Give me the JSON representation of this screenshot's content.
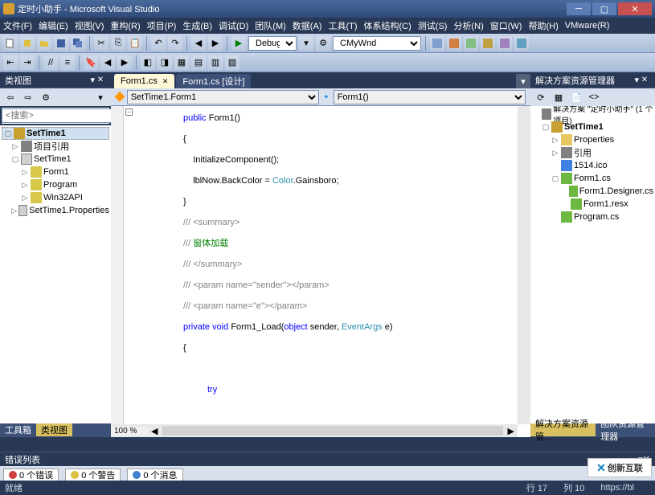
{
  "title": "定时小助手 - Microsoft Visual Studio",
  "window_buttons": {
    "min": "─",
    "max": "▢",
    "close": "✕"
  },
  "menu": [
    "文件(F)",
    "编辑(E)",
    "视图(V)",
    "重构(R)",
    "项目(P)",
    "生成(B)",
    "调试(D)",
    "团队(M)",
    "数据(A)",
    "工具(T)",
    "体系结构(C)",
    "测试(S)",
    "分析(N)",
    "窗口(W)",
    "帮助(H)",
    "VMware(R)"
  ],
  "toolbar": {
    "config": "Debug",
    "target": "CMyWnd"
  },
  "left_panel": {
    "title": "类视图",
    "search_placeholder": "<搜索>",
    "tree": {
      "root": "SetTime1",
      "refs": "项目引用",
      "ns": "SetTime1",
      "cls1": "Form1",
      "cls2": "Program",
      "cls3": "Win32API",
      "ns2": "SetTime1.Properties"
    },
    "tabs": {
      "toolbox": "工具箱",
      "classview": "类视图"
    }
  },
  "doc": {
    "tabs": {
      "active": "Form1.cs",
      "other": "Form1.cs [设计]"
    },
    "nav_left": "SetTime1.Form1",
    "nav_right": "Form1()",
    "zoom": "100 %",
    "code": {
      "l1_kw": "public",
      "l1_rest": " Form1()",
      "l2": "{",
      "l3": "    InitializeComponent();",
      "l4a": "    lblNow.BackColor = ",
      "l4b": "Color",
      "l4c": ".Gainsboro;",
      "l5": "}",
      "l6": "/// <summary>",
      "l7a": "/// ",
      "l7b": "窗体加载",
      "l8": "/// </summary>",
      "l9": "/// <param name=\"sender\"></param>",
      "l10": "/// <param name=\"e\"></param>",
      "l11_kw1": "private",
      "l11_kw2": "void",
      "l11_m": " Form1_Load(",
      "l11_kw3": "object",
      "l11_p": " sender, ",
      "l11_t": "EventArgs",
      "l11_e": " e)",
      "l12": "{",
      "l13": "",
      "l14_kw": "try"
    }
  },
  "right_panel": {
    "title": "解决方案资源管理器",
    "sln": "解决方案 \"定时小助手\" (1 个项目)",
    "proj": "SetTime1",
    "props": "Properties",
    "refs": "引用",
    "ico": "1514.ico",
    "form": "Form1.cs",
    "designer": "Form1.Designer.cs",
    "resx": "Form1.resx",
    "program": "Program.cs",
    "tabs": {
      "sln": "解决方案资源管...",
      "team": "团队资源管理器"
    }
  },
  "error_list": {
    "title": "错误列表",
    "errors": "0 个错误",
    "warnings": "0 个警告",
    "messages": "0 个消息"
  },
  "status": {
    "ready": "就绪",
    "line_lbl": "行",
    "line": "17",
    "col_lbl": "列",
    "col": "10",
    "url": "https://bl"
  },
  "watermark": "创新互联"
}
